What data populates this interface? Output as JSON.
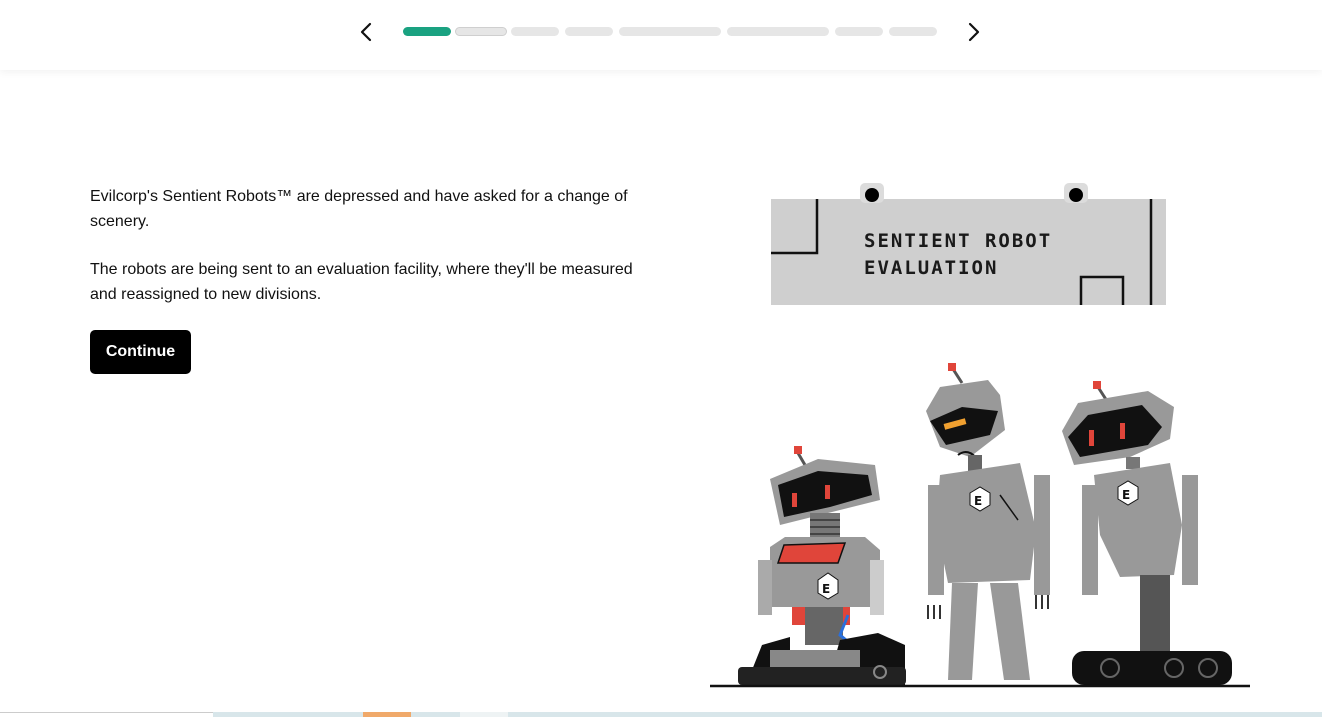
{
  "progress": {
    "total_steps": 8,
    "completed_steps": 1,
    "current_step": 2
  },
  "content": {
    "paragraph_1": "Evilcorp's Sentient Robots™ are depressed and have asked for a change of scenery.",
    "paragraph_2": "The robots are being sent to an evaluation facility, where they'll be measured and reassigned to new divisions.",
    "continue_label": "Continue"
  },
  "illustration": {
    "sign_line_1": "SENTIENT ROBOT",
    "sign_line_2": "EVALUATION",
    "robot_badge": "E"
  },
  "icons": {
    "prev": "chevron-left-icon",
    "next": "chevron-right-icon"
  },
  "colors": {
    "progress_active": "#1aa281",
    "progress_inactive": "#e6e6e6",
    "button_bg": "#000000",
    "robot_gray": "#999999",
    "robot_accent_red": "#e0453a",
    "robot_accent_orange": "#f0a030"
  }
}
